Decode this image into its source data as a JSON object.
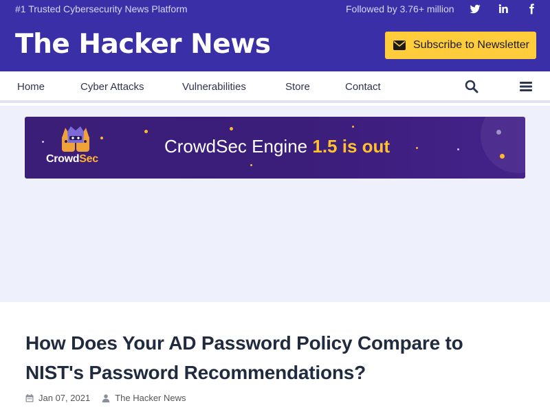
{
  "topbar": {
    "tagline": "#1 Trusted Cybersecurity News Platform",
    "followed": "Followed by 3.76+ million",
    "social": [
      "twitter-icon",
      "linkedin-icon",
      "facebook-icon"
    ]
  },
  "header": {
    "logo": "The Hacker News",
    "subscribe_label": "Subscribe to Newsletter"
  },
  "nav": {
    "items": [
      "Home",
      "Cyber Attacks",
      "Vulnerabilities",
      "Store",
      "Contact"
    ],
    "icons": [
      "search-icon",
      "menu-icon"
    ]
  },
  "ad": {
    "brand_prefix": "Crowd",
    "brand_suffix": "Sec",
    "headline_prefix": "CrowdSec Engine",
    "headline_highlight": "1.5 is out"
  },
  "article": {
    "title": "How Does Your AD Password Policy Compare to NIST's Password Recommendations?",
    "date": "Jan 07, 2021",
    "author": "The Hacker News"
  },
  "colors": {
    "brand": "#3a2fa6",
    "accent": "#ffcd3c",
    "ad_background": "#eef1fb",
    "banner": "#3b1d7a"
  }
}
